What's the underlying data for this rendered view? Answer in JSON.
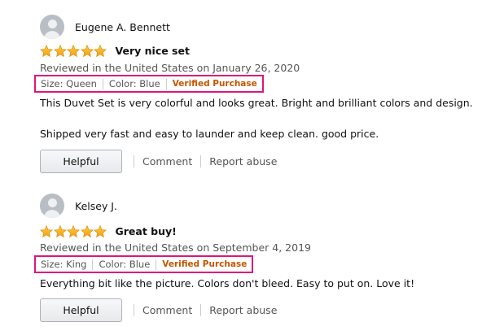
{
  "reviews": [
    {
      "name": "Eugene A. Bennett",
      "rating": 5,
      "title": "Very nice set",
      "date": "Reviewed in the United States on January 26, 2020",
      "size": "Size: Queen",
      "color": "Color: Blue",
      "verified": "Verified Purchase",
      "text1": "This Duvet Set is very colorful and looks great. Bright and brilliant colors and design.",
      "text2": "Shipped very fast and easy to launder and keep clean. good price.",
      "helpful": "Helpful",
      "comment": "Comment",
      "report": "Report abuse"
    },
    {
      "name": "Kelsey J.",
      "rating": 5,
      "title": "Great buy!",
      "date": "Reviewed in the United States on September 4, 2019",
      "size": "Size: King",
      "color": "Color: Blue",
      "verified": "Verified Purchase",
      "text1": "Everything bit like the picture. Colors don't bleed. Easy to put on. Love it!",
      "helpful": "Helpful",
      "comment": "Comment",
      "report": "Report abuse"
    }
  ],
  "colors": {
    "star": "#ffa41c",
    "verified": "#c45500",
    "highlight_box": "#e0157a"
  },
  "icons": {
    "avatar": "user-silhouette-icon",
    "star": "star-icon"
  }
}
